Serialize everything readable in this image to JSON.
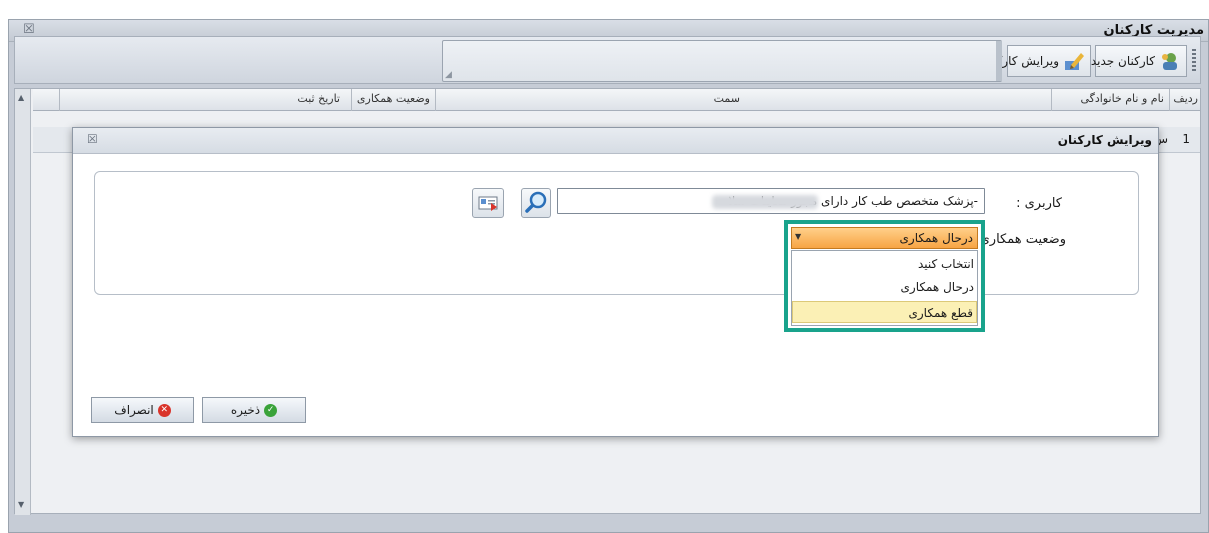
{
  "window": {
    "title": "مدیریت کارکنان",
    "close_glyph": "☒"
  },
  "toolbar": {
    "new_label": "کارکنان جدید",
    "edit_label": "ویرایش کارکنان",
    "search_resize_glyph": "◢"
  },
  "grid": {
    "headers": [
      "ردیف",
      "نام و نام خانوادگی",
      "سمت",
      "وضعیت همکاری",
      "تاریخ ثبت"
    ],
    "row_number": "1",
    "row_partial": "س"
  },
  "dialog": {
    "title": "ویرایش کارکنان",
    "close_glyph": "☒",
    "user_label": "کاربری :",
    "status_label": "وضعیت همکاری :",
    "user_value": "-پزشک متخصص طب کار دارای مجوز معاینات سلا",
    "status_selected": "درحال همکاری",
    "status_options": [
      "انتخاب کنید",
      "درحال همکاری",
      "قطع همکاری"
    ],
    "save_label": "ذخیره",
    "cancel_label": "انصراف"
  },
  "colors": {
    "highlight_border": "#19a38c",
    "combo_orange": "#f7a444",
    "save_icon": "#3aa33a",
    "cancel_icon": "#d9342b",
    "hover_option": "#fbf0b5"
  },
  "icons": {
    "search": "magnifier-icon",
    "card": "id-card-icon",
    "new": "add-user-icon",
    "edit": "pencil-edit-icon"
  }
}
